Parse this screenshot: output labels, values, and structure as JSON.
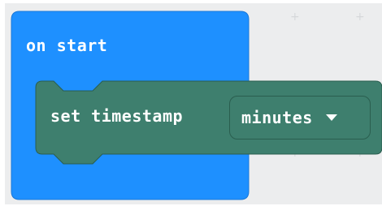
{
  "on_start_block": {
    "label": "on start",
    "color": "#1e90ff"
  },
  "set_timestamp_block": {
    "label": "set timestamp",
    "color": "#3e7f6e",
    "dropdown": {
      "selected": "minutes",
      "icon": "caret-down-icon"
    }
  }
}
